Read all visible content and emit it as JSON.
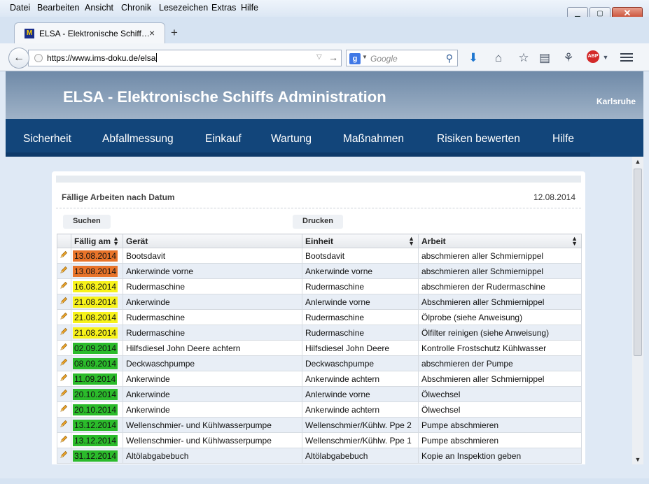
{
  "menubar": [
    "Datei",
    "Bearbeiten",
    "Ansicht",
    "Chronik",
    "Lesezeichen",
    "Extras",
    "Hilfe"
  ],
  "tab": {
    "title": "ELSA - Elektronische Schiff…",
    "favicon_letter": "M"
  },
  "navbar": {
    "url": "https://www.ims-doku.de/elsa",
    "search_placeholder": "Google",
    "search_engine_letter": "g",
    "abp_label": "ABP"
  },
  "header": {
    "title": "ELSA - Elektronische Schiffs Administration",
    "location": "Karlsruhe"
  },
  "mainnav": [
    "Sicherheit",
    "Abfallmessung",
    "Einkauf",
    "Wartung",
    "Maßnahmen",
    "Risiken bewerten",
    "Hilfe"
  ],
  "panel": {
    "title": "Fällige Arbeiten nach Datum",
    "date": "12.08.2014",
    "search_label": "Suchen",
    "print_label": "Drucken"
  },
  "table": {
    "columns": [
      "Fällig am",
      "Gerät",
      "Einheit",
      "Arbeit"
    ],
    "rows": [
      {
        "date": "13.08.2014",
        "status": "orange",
        "geraet": "Bootsdavit",
        "einheit": "Bootsdavit",
        "arbeit": "abschmieren aller Schmiernippel"
      },
      {
        "date": "13.08.2014",
        "status": "orange",
        "geraet": "Ankerwinde vorne",
        "einheit": "Ankerwinde vorne",
        "arbeit": "abschmieren aller Schmiernippel"
      },
      {
        "date": "16.08.2014",
        "status": "yellow",
        "geraet": "Rudermaschine",
        "einheit": "Rudermaschine",
        "arbeit": "abschmieren der Rudermaschine"
      },
      {
        "date": "21.08.2014",
        "status": "yellow",
        "geraet": "Ankerwinde",
        "einheit": "Anlerwinde vorne",
        "arbeit": "Abschmieren aller Schmiernippel"
      },
      {
        "date": "21.08.2014",
        "status": "yellow",
        "geraet": "Rudermaschine",
        "einheit": "Rudermaschine",
        "arbeit": "Ölprobe (siehe Anweisung)"
      },
      {
        "date": "21.08.2014",
        "status": "yellow",
        "geraet": "Rudermaschine",
        "einheit": "Rudermaschine",
        "arbeit": "Ölfilter reinigen (siehe Anweisung)"
      },
      {
        "date": "02.09.2014",
        "status": "green",
        "geraet": "Hilfsdiesel John Deere achtern",
        "einheit": "Hilfsdiesel John Deere",
        "arbeit": "Kontrolle Frostschutz Kühlwasser"
      },
      {
        "date": "08.09.2014",
        "status": "green",
        "geraet": "Deckwaschpumpe",
        "einheit": "Deckwaschpumpe",
        "arbeit": "abschmieren der Pumpe"
      },
      {
        "date": "11.09.2014",
        "status": "green",
        "geraet": "Ankerwinde",
        "einheit": "Ankerwinde achtern",
        "arbeit": "Abschmieren aller Schmiernippel"
      },
      {
        "date": "20.10.2014",
        "status": "green",
        "geraet": "Ankerwinde",
        "einheit": "Anlerwinde vorne",
        "arbeit": "Ölwechsel"
      },
      {
        "date": "20.10.2014",
        "status": "green",
        "geraet": "Ankerwinde",
        "einheit": "Ankerwinde achtern",
        "arbeit": "Ölwechsel"
      },
      {
        "date": "13.12.2014",
        "status": "green",
        "geraet": "Wellenschmier- und Kühlwasserpumpe",
        "einheit": "Wellenschmier/Kühlw. Ppe 2",
        "arbeit": "Pumpe abschmieren"
      },
      {
        "date": "13.12.2014",
        "status": "green",
        "geraet": "Wellenschmier- und Kühlwasserpumpe",
        "einheit": "Wellenschmier/Kühlw. Ppe 1",
        "arbeit": "Pumpe abschmieren"
      },
      {
        "date": "31.12.2014",
        "status": "green",
        "geraet": "Altölabgabebuch",
        "einheit": "Altölabgabebuch",
        "arbeit": "Kopie an Inspektion geben"
      }
    ]
  },
  "colors": {
    "orange": "#e8742a",
    "yellow": "#f7f21a",
    "green": "#2bbb2b",
    "nav": "#12457a",
    "accent": "#f09a1a"
  },
  "icons": [
    "back-arrow-icon",
    "globe-icon",
    "dropdown-arrow-icon",
    "go-arrow-icon",
    "google-icon",
    "magnifier-icon",
    "download-icon",
    "home-icon",
    "star-icon",
    "reading-list-icon",
    "extension-icon",
    "adblock-icon",
    "menu-icon",
    "pencil-icon",
    "sort-icon"
  ]
}
